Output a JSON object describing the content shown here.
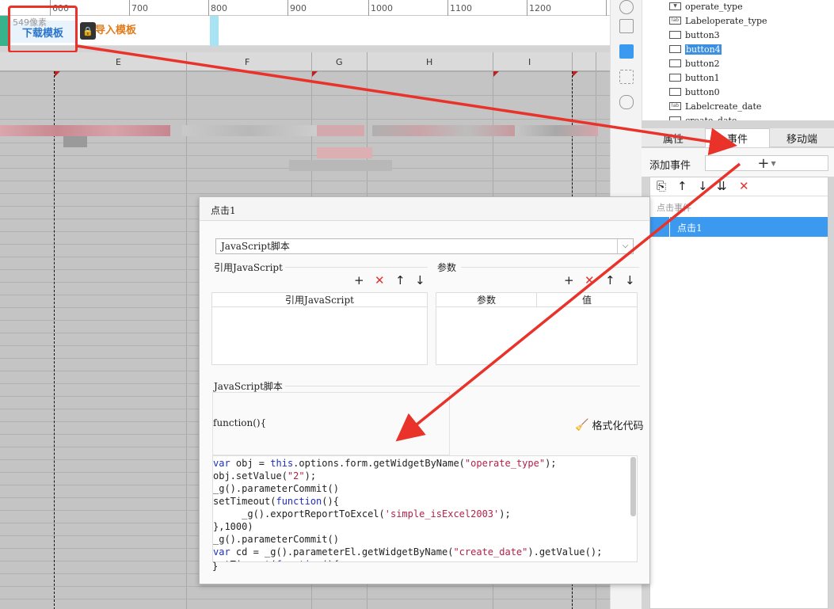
{
  "ruler": {
    "ticks": [
      "600",
      "700",
      "800",
      "900",
      "1000",
      "1100",
      "1200"
    ]
  },
  "toolbar_strip": {
    "download_label": "下载模板",
    "pixel_hint": "549像素",
    "import_label": "导入模板",
    "lock_icon": "lock-icon"
  },
  "grid": {
    "columns": [
      "E",
      "F",
      "G",
      "H",
      "I"
    ]
  },
  "widget_tree": {
    "items": [
      {
        "label": "operate_type",
        "icon": "combo"
      },
      {
        "label": "Labeloperate_type",
        "icon": "lab"
      },
      {
        "label": "button3",
        "icon": "button"
      },
      {
        "label": "button4",
        "icon": "button",
        "selected": true
      },
      {
        "label": "button2",
        "icon": "button"
      },
      {
        "label": "button1",
        "icon": "button"
      },
      {
        "label": "button0",
        "icon": "button"
      },
      {
        "label": "Labelcreate_date",
        "icon": "lab"
      },
      {
        "label": "create_date",
        "icon": "date"
      }
    ]
  },
  "tabs": [
    {
      "label": "属性",
      "active": false
    },
    {
      "label": "事件",
      "active": true
    },
    {
      "label": "移动端",
      "active": false
    }
  ],
  "events": {
    "add_label": "添加事件",
    "add_icon": "+",
    "section_title": "点击事件",
    "items": [
      {
        "label": "点击1",
        "selected": true
      }
    ]
  },
  "dialog": {
    "title": "点击1",
    "script_type": "JavaScript脚本",
    "ref_section": "引用JavaScript",
    "params_section": "参数",
    "ref_table_header": "引用JavaScript",
    "params_table_headers": [
      "参数",
      "值"
    ],
    "script_section": "JavaScript脚本",
    "function_header": "function(){",
    "format_button": "格式化代码",
    "closing_brace": "}",
    "code_lines": [
      "var obj = this.options.form.getWidgetByName(\"operate_type\");",
      "obj.setValue(\"2\");",
      "_g().parameterCommit()",
      "setTimeout(function(){",
      "     _g().exportReportToExcel('simple_isExcel2003');",
      "},1000)",
      "_g().parameterCommit()",
      "var cd = _g().parameterEl.getWidgetByName(\"create_date\").getValue();",
      "setTimeout(function(){"
    ]
  },
  "colors": {
    "accent": "#3b9af0",
    "annotation": "#e8322a",
    "download_text": "#2a74c9",
    "import_text": "#e07b1a"
  }
}
